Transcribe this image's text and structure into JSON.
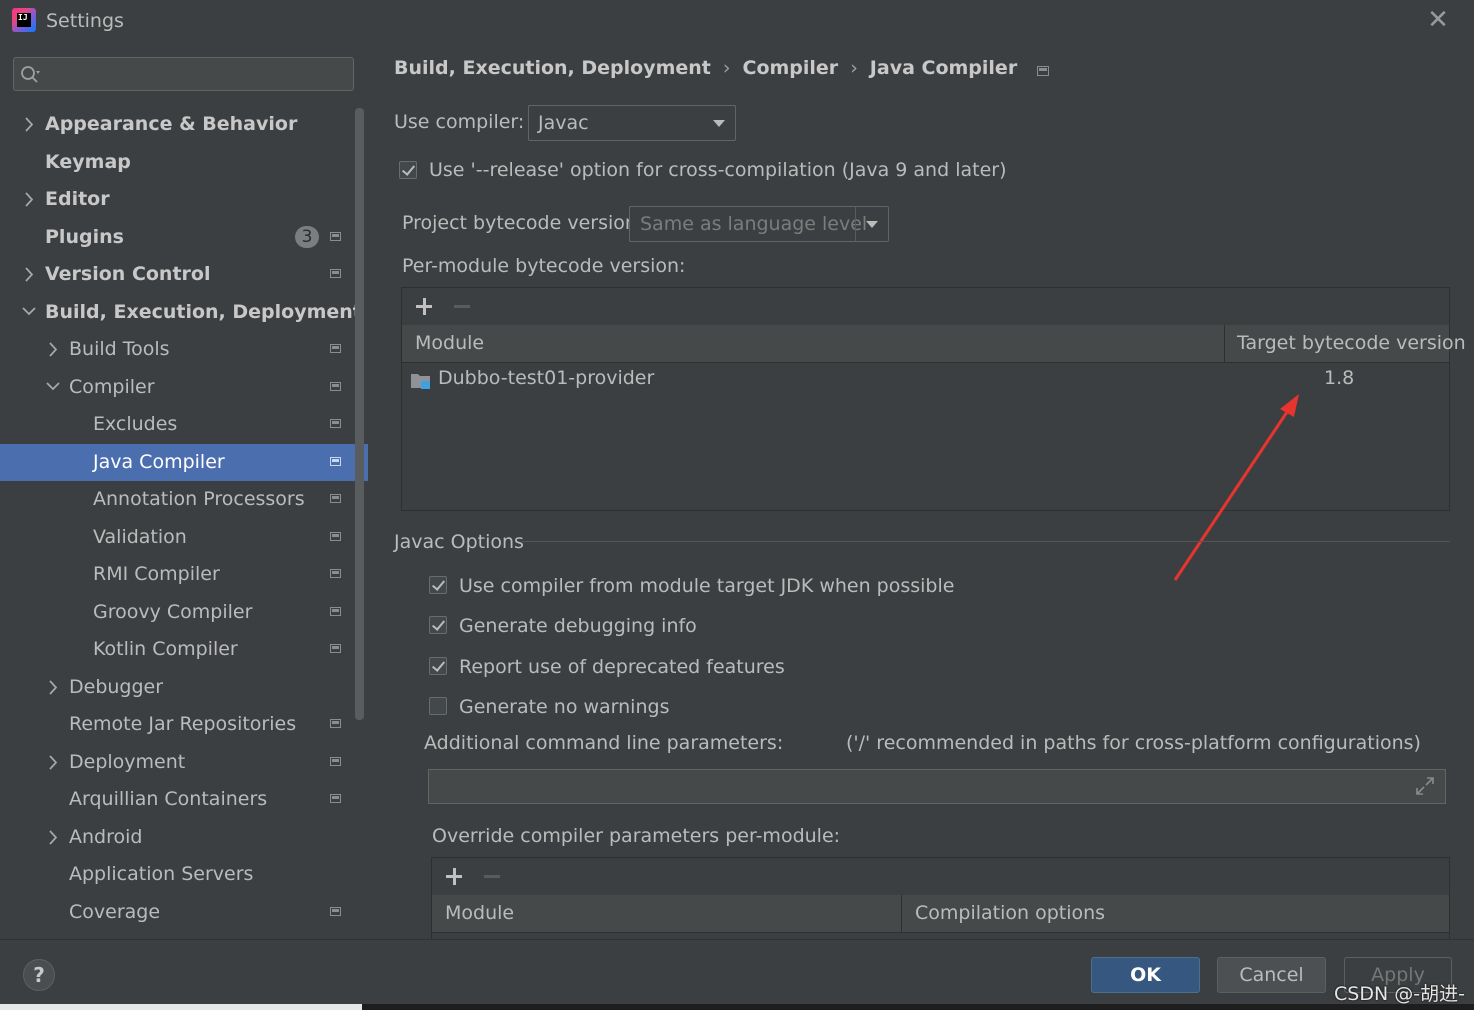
{
  "window": {
    "title": "Settings",
    "logo_text": "IJ"
  },
  "sidebar": {
    "search": {
      "placeholder": "",
      "value": ""
    },
    "items": [
      {
        "label": "Appearance & Behavior",
        "level": 0,
        "expandable": true,
        "expanded": false,
        "bold": true,
        "project_icon": false
      },
      {
        "label": "Keymap",
        "level": 0,
        "expandable": false,
        "bold": true,
        "project_icon": false
      },
      {
        "label": "Editor",
        "level": 0,
        "expandable": true,
        "expanded": false,
        "bold": true,
        "project_icon": false
      },
      {
        "label": "Plugins",
        "level": 0,
        "expandable": false,
        "bold": true,
        "badge": "3",
        "project_icon": true
      },
      {
        "label": "Version Control",
        "level": 0,
        "expandable": true,
        "expanded": false,
        "bold": true,
        "project_icon": true
      },
      {
        "label": "Build, Execution, Deployment",
        "level": 0,
        "expandable": true,
        "expanded": true,
        "bold": true,
        "project_icon": false
      },
      {
        "label": "Build Tools",
        "level": 1,
        "expandable": true,
        "expanded": false,
        "project_icon": true
      },
      {
        "label": "Compiler",
        "level": 1,
        "expandable": true,
        "expanded": true,
        "project_icon": true
      },
      {
        "label": "Excludes",
        "level": 2,
        "expandable": false,
        "project_icon": true
      },
      {
        "label": "Java Compiler",
        "level": 2,
        "expandable": false,
        "project_icon": true,
        "selected": true
      },
      {
        "label": "Annotation Processors",
        "level": 2,
        "expandable": false,
        "project_icon": true
      },
      {
        "label": "Validation",
        "level": 2,
        "expandable": false,
        "project_icon": true
      },
      {
        "label": "RMI Compiler",
        "level": 2,
        "expandable": false,
        "project_icon": true
      },
      {
        "label": "Groovy Compiler",
        "level": 2,
        "expandable": false,
        "project_icon": true
      },
      {
        "label": "Kotlin Compiler",
        "level": 2,
        "expandable": false,
        "project_icon": true
      },
      {
        "label": "Debugger",
        "level": 1,
        "expandable": true,
        "expanded": false,
        "project_icon": false
      },
      {
        "label": "Remote Jar Repositories",
        "level": 1,
        "expandable": false,
        "project_icon": true
      },
      {
        "label": "Deployment",
        "level": 1,
        "expandable": true,
        "expanded": false,
        "project_icon": true
      },
      {
        "label": "Arquillian Containers",
        "level": 1,
        "expandable": false,
        "project_icon": true
      },
      {
        "label": "Android",
        "level": 1,
        "expandable": true,
        "expanded": false,
        "project_icon": false
      },
      {
        "label": "Application Servers",
        "level": 1,
        "expandable": false,
        "project_icon": false
      },
      {
        "label": "Coverage",
        "level": 1,
        "expandable": false,
        "project_icon": true
      }
    ]
  },
  "breadcrumb": [
    "Build, Execution, Deployment",
    "Compiler",
    "Java Compiler"
  ],
  "compiler": {
    "use_compiler_label": "Use compiler:",
    "use_compiler_value": "Javac",
    "release_option": {
      "label": "Use '--release' option for cross-compilation (Java 9 and later)",
      "checked": true
    },
    "project_bytecode_label": "Project bytecode version:",
    "project_bytecode_value": "Same as language level",
    "per_module_label": "Per-module bytecode version:",
    "per_module_table": {
      "columns": [
        "Module",
        "Target bytecode version"
      ],
      "rows": [
        {
          "module": "Dubbo-test01-provider",
          "version": "1.8"
        }
      ]
    }
  },
  "javac": {
    "section_title": "Javac Options",
    "options": [
      {
        "label": "Use compiler from module target JDK when possible",
        "checked": true
      },
      {
        "label": "Generate debugging info",
        "checked": true
      },
      {
        "label": "Report use of deprecated features",
        "checked": true
      },
      {
        "label": "Generate no warnings",
        "checked": false
      }
    ],
    "additional_params_label": "Additional command line parameters:",
    "additional_params_hint": "('/' recommended in paths for cross-platform configurations)",
    "additional_params_value": "",
    "override_label": "Override compiler parameters per-module:",
    "override_table": {
      "columns": [
        "Module",
        "Compilation options"
      ],
      "rows": []
    }
  },
  "buttons": {
    "ok": "OK",
    "cancel": "Cancel",
    "apply": "Apply",
    "help": "?"
  },
  "watermark": "CSDN @-胡进-",
  "colors": {
    "selection": "#4b6eaf",
    "background": "#3c3f41",
    "annotation_arrow": "#e8342e",
    "ok_button": "#365880"
  }
}
